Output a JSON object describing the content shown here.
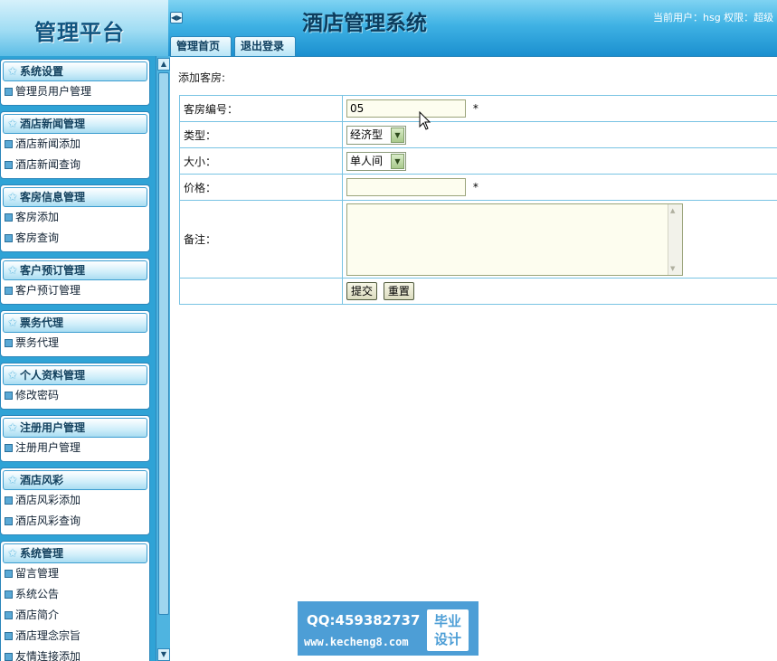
{
  "header": {
    "logo": "管理平台",
    "system_title": "酒店管理系统",
    "user_info": "当前用户：hsg 权限：超级",
    "toggle_icon": "toggle-arrows-icon",
    "tabs": [
      {
        "label": "管理首页"
      },
      {
        "label": "退出登录"
      }
    ]
  },
  "sidebar": {
    "groups": [
      {
        "title": "系统设置",
        "items": [
          "管理员用户管理"
        ]
      },
      {
        "title": "酒店新闻管理",
        "items": [
          "酒店新闻添加",
          "酒店新闻查询"
        ]
      },
      {
        "title": "客房信息管理",
        "items": [
          "客房添加",
          "客房查询"
        ]
      },
      {
        "title": "客户预订管理",
        "items": [
          "客户预订管理"
        ]
      },
      {
        "title": "票务代理",
        "items": [
          "票务代理"
        ]
      },
      {
        "title": "个人资料管理",
        "items": [
          "修改密码"
        ]
      },
      {
        "title": "注册用户管理",
        "items": [
          "注册用户管理"
        ]
      },
      {
        "title": "酒店风彩",
        "items": [
          "酒店风彩添加",
          "酒店风彩查询"
        ]
      },
      {
        "title": "系统管理",
        "items": [
          "留言管理",
          "系统公告",
          "酒店简介",
          "酒店理念宗旨",
          "友情连接添加"
        ]
      }
    ]
  },
  "form": {
    "title": "添加客房:",
    "room_no": {
      "label": "客房编号：",
      "value": "05",
      "required_mark": "*"
    },
    "type": {
      "label": "类型：",
      "selected": "经济型"
    },
    "size": {
      "label": "大小：",
      "selected": "单人间"
    },
    "price": {
      "label": "价格：",
      "value": "",
      "required_mark": "*"
    },
    "remark": {
      "label": "备注：",
      "value": ""
    },
    "submit_label": "提交",
    "reset_label": "重置"
  },
  "watermark": {
    "qq": "QQ:459382737",
    "site": "www.kecheng8.com",
    "badge_line1": "毕业",
    "badge_line2": "设计"
  }
}
